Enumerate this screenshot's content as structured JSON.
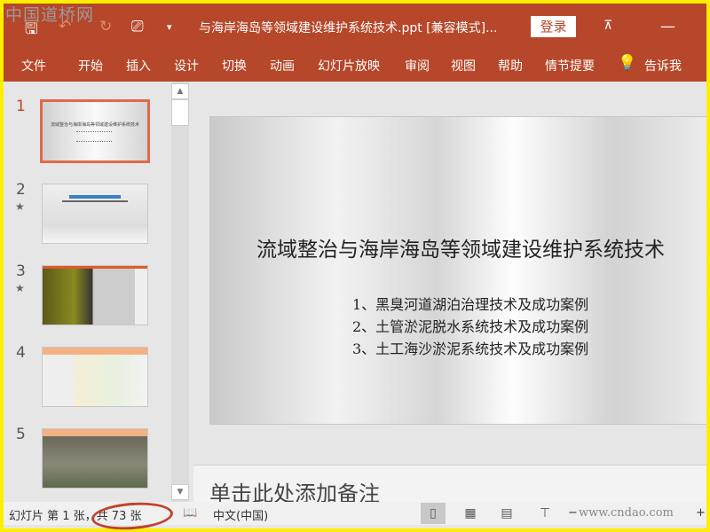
{
  "watermark": "中国道桥网",
  "titlebar": {
    "title": "与海岸海岛等领域建设维护系统技术.ppt [兼容模式]...",
    "login": "登录",
    "qat_more": "▾"
  },
  "ribbon": {
    "tabs": [
      "文件",
      "开始",
      "插入",
      "设计",
      "切换",
      "动画",
      "幻灯片放映",
      "审阅",
      "视图",
      "帮助",
      "情节提要"
    ],
    "tell_me": "告诉我"
  },
  "thumbnails": [
    {
      "num": "1"
    },
    {
      "num": "2",
      "star": "★"
    },
    {
      "num": "3",
      "star": "★"
    },
    {
      "num": "4"
    },
    {
      "num": "5"
    }
  ],
  "thumb1": {
    "title": "流域整治与海岸海岛等领域建设维护系统技术"
  },
  "slide": {
    "title": "流域整治与海岸海岛等领域建设维护系统技术",
    "items": [
      "1、黑臭河道湖泊治理技术及成功案例",
      "2、土管淤泥脱水系统技术及成功案例",
      "3、土工海沙淤泥系统技术及成功案例"
    ]
  },
  "notes": {
    "placeholder": "单击此处添加备注"
  },
  "status": {
    "slide_info": "幻灯片 第 1 张，共 73 张",
    "language": "中文(中国)",
    "zoom_watermark": "www.cndao.com"
  },
  "colors": {
    "accent": "#b7472a",
    "selected_border": "#e0694a"
  }
}
